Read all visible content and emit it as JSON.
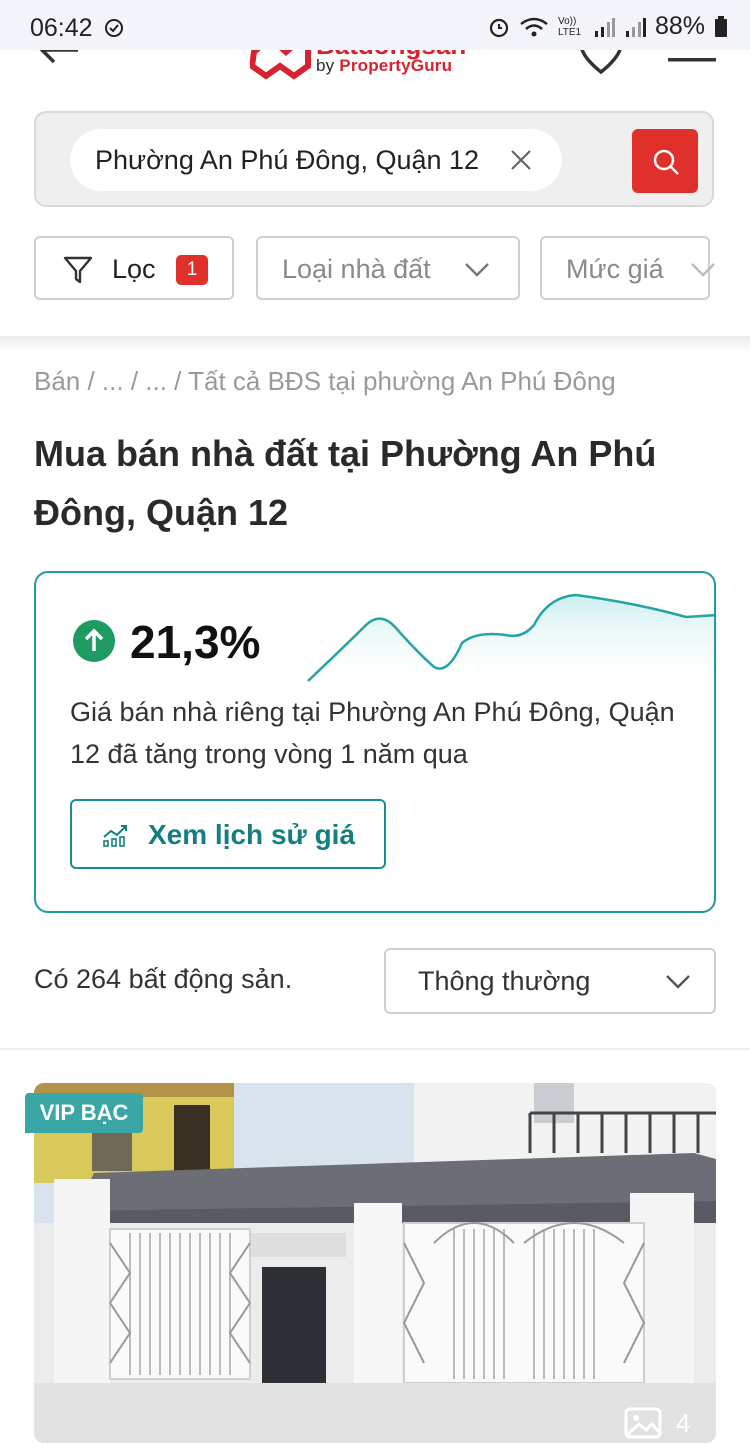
{
  "status_bar": {
    "time": "06:42",
    "net_label": "Vo)) LTE1",
    "battery": "88%"
  },
  "header": {
    "logo_brand": "Batdongsan",
    "logo_sub_prefix": "by ",
    "logo_sub": "PropertyGuru"
  },
  "search": {
    "query": "Phường An Phú Đông, Quận 12"
  },
  "filters": [
    {
      "label": "Lọc",
      "badge": "1"
    },
    {
      "label": "Loại nhà đất"
    },
    {
      "label": "Mức giá"
    }
  ],
  "breadcrumb": "Bán / ... / ... / Tất cả BĐS tại phường An Phú Đông",
  "page_title": "Mua bán nhà đất tại Phường An Phú Đông, Quận 12",
  "price_card": {
    "change": "21,3%",
    "description": "Giá bán nhà riêng tại Phường An Phú Đông, Quận 12 đã tăng trong vòng 1 năm qua",
    "history_button": "Xem lịch sử giá",
    "accent_color": "#1d9d9d"
  },
  "results": {
    "count_text": "Có 264 bất động sản.",
    "sort_selected": "Thông thường"
  },
  "listing": {
    "badge": "VIP BẠC",
    "photo_count": "4"
  },
  "colors": {
    "brand_red": "#e0302b",
    "teal": "#1d9d9d"
  }
}
